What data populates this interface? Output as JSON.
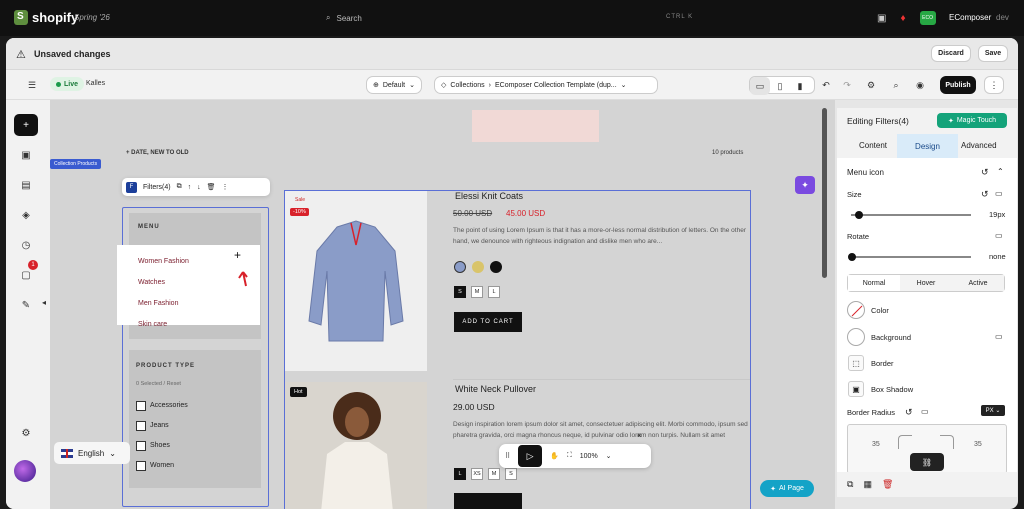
{
  "topbar": {
    "brand": "shopify",
    "release": "Spring '26",
    "search_placeholder": "Search",
    "shortcut": "CTRL  K",
    "store_badge": "ECO",
    "store_name": "EComposer",
    "store_env": "dev",
    "notification_icon": "bell-icon"
  },
  "savebar": {
    "title": "Unsaved changes",
    "discard": "Discard",
    "save": "Save"
  },
  "toolbar": {
    "live": "Live",
    "theme": "Kalles",
    "view": "Default",
    "breadcrumb_1": "Collections",
    "breadcrumb_2": "EComposer Collection Template (dup...",
    "publish": "Publish"
  },
  "rail": {
    "notification_count": "1"
  },
  "canvas": {
    "sort_label": "DATE, NEW TO OLD",
    "product_count": "10 products",
    "section_tag": "Collection Products",
    "floatbar_label": "Filters(4)",
    "menu_title": "MENU",
    "menu_items": [
      "Women Fashion",
      "Watches",
      "Men Fashion",
      "Skin care"
    ],
    "ptype_title": "PRODUCT TYPE",
    "ptype_selected": "0 Selected  /  Reset",
    "ptype_items": [
      "Accessories",
      "Jeans",
      "Shoes",
      "Women"
    ],
    "product1": {
      "sale": "Sale",
      "discount": "-10%",
      "title": "Elessi Knit Coats",
      "old_price": "50.00 USD",
      "new_price": "45.00 USD",
      "desc": "The point of using Lorem Ipsum is that it has a more-or-less normal distribution of letters. On the other hand, we denounce with righteous indignation and dislike men who are...",
      "sizes": [
        "S",
        "M",
        "L"
      ],
      "cta": "ADD TO CART"
    },
    "product2": {
      "badge": "Hot",
      "title": "White Neck Pullover",
      "price": "29.00 USD",
      "desc": "Design inspiration lorem ipsum dolor sit amet, consectetuer adipiscing elit. Morbi commodo, ipsum sed pharetra gravida, orci magna rhoncus neque, id pulvinar odio lorem non turpis. Nullam sit amet",
      "sizes": [
        "L",
        "XS",
        "M",
        "S"
      ]
    },
    "language": "English",
    "zoom": "100%",
    "ai_page": "AI Page"
  },
  "panel": {
    "title": "Editing Filters(4)",
    "magic": "Magic Touch",
    "tabs": [
      "Content",
      "Design",
      "Advanced"
    ],
    "menu_icon": "Menu icon",
    "size_label": "Size",
    "size_value": "19px",
    "rotate_label": "Rotate",
    "rotate_value": "none",
    "states": [
      "Normal",
      "Hover",
      "Active"
    ],
    "color": "Color",
    "background": "Background",
    "border": "Border",
    "box_shadow": "Box Shadow",
    "border_radius": "Border Radius",
    "unit": "PX",
    "radius_left": "35",
    "radius_right": "35"
  },
  "colors": {
    "accent_blue": "#5a6fd6",
    "sale_red": "#d8212a",
    "live_green": "#1a9a4a",
    "magic_green": "#14a37a"
  }
}
